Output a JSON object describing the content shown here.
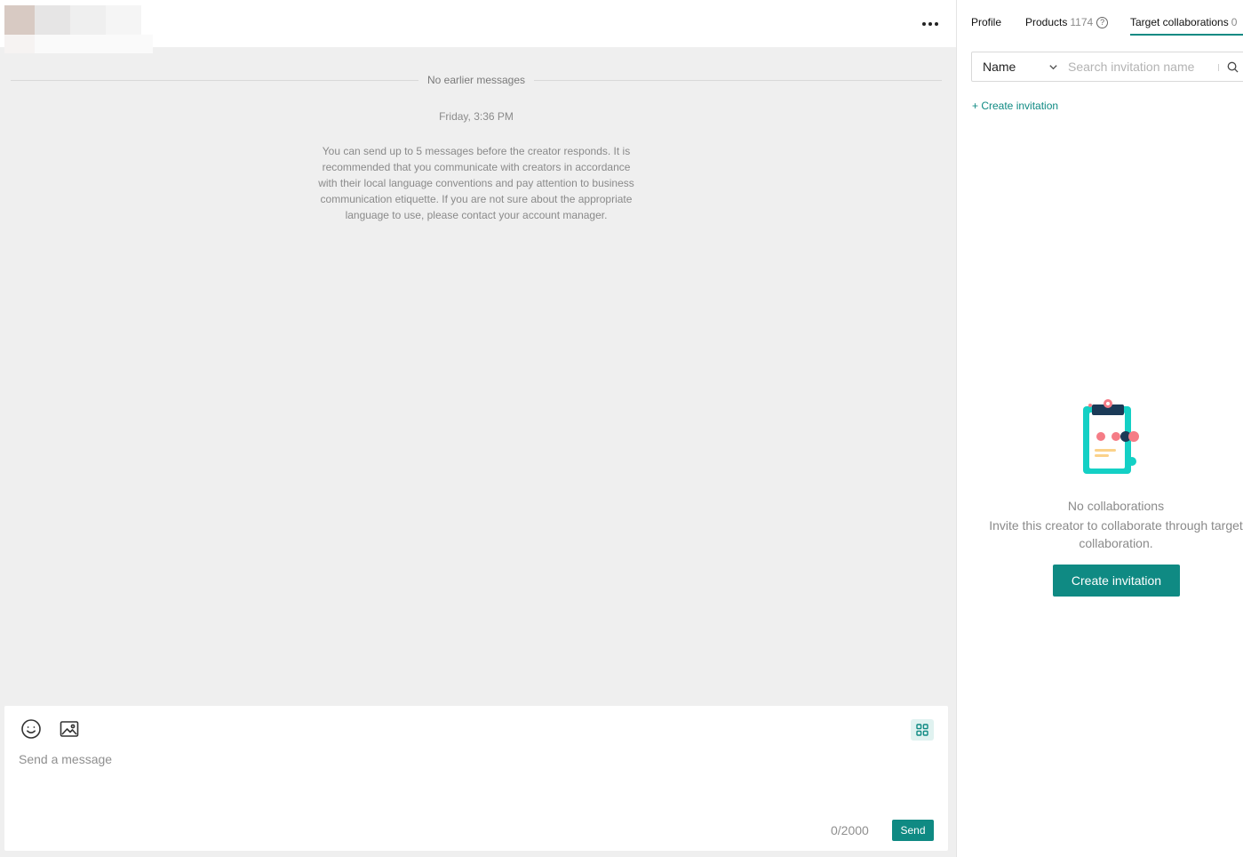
{
  "chat": {
    "no_earlier": "No earlier messages",
    "timestamp": "Friday, 3:36 PM",
    "notice": "You can send up to 5 messages before the creator responds. It is recommended that you communicate with creators in accordance with their local language conventions and pay attention to business communication etiquette. If you are not sure about the appropriate language to use, please contact your account manager.",
    "composer": {
      "placeholder": "Send a message",
      "counter": "0/2000",
      "send_label": "Send"
    }
  },
  "panel": {
    "tabs": [
      {
        "label": "Profile"
      },
      {
        "label": "Products",
        "count": "1174"
      },
      {
        "label": "Target collaborations",
        "count": "0"
      }
    ],
    "search": {
      "select_value": "Name",
      "placeholder": "Search invitation name"
    },
    "create_link": "+ Create invitation",
    "empty": {
      "title": "No collaborations",
      "description": "Invite this creator to collaborate through target collaboration.",
      "button": "Create invitation"
    }
  },
  "colors": {
    "accent": "#0f8a83",
    "chat_bg": "#efefef"
  }
}
